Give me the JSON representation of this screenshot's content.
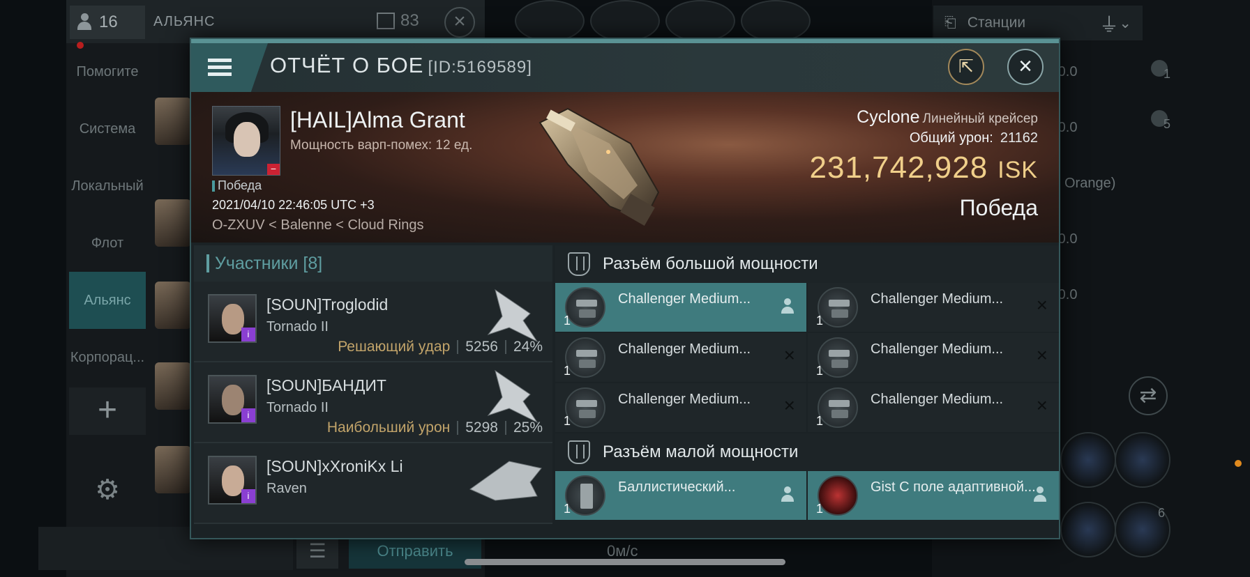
{
  "background": {
    "user_count": "16",
    "channel_name": "АЛЬЯНС",
    "message_count": "83",
    "tabs": [
      "Помогите",
      "Система",
      "Локальный",
      "Флот",
      "Альянс",
      "Корпорац..."
    ],
    "active_tab": "Альянс",
    "send_label": "Отправить",
    "stations_label": "Станции",
    "stat_values": [
      "-0.0",
      "-0.0",
      "-0.0",
      "-0.0"
    ],
    "stat_counts": [
      "1",
      "5"
    ],
    "orange_tag": "Orange)",
    "speed": "0м/с",
    "module_badge": "6"
  },
  "modal": {
    "title": "ОТЧЁТ О БОЕ",
    "report_id": "[ID:5169589]",
    "victim": {
      "name": "[HAIL]Alma Grant",
      "warp_disrupt": "Мощность варп-помех: 12 ед.",
      "result": "Победа",
      "datetime": "2021/04/10 22:46:05 UTC +3",
      "location": "O-ZXUV < Balenne < Cloud Rings",
      "ship_name": "Cyclone",
      "ship_class": "Линейный крейсер",
      "damage_label": "Общий урон:",
      "damage_value": "21162",
      "isk_value": "231,742,928",
      "isk_unit": "ISK",
      "outcome": "Победа"
    },
    "participants": {
      "title": "Участники [8]",
      "rows": [
        {
          "name": "[SOUN]Troglodid",
          "ship": "Tornado II",
          "label": "Решающий удар",
          "damage": "5256",
          "percent": "24%"
        },
        {
          "name": "[SOUN]БАНДИТ",
          "ship": "Tornado II",
          "label": "Наибольший урон",
          "damage": "5298",
          "percent": "25%"
        },
        {
          "name": "[SOUN]xXroniKx Li",
          "ship": "Raven",
          "label": "",
          "damage": "",
          "percent": ""
        }
      ]
    },
    "high_slots": {
      "title": "Разъём большой мощности",
      "modules": [
        {
          "name": "Challenger Medium...",
          "qty": "1",
          "status": "dropped"
        },
        {
          "name": "Challenger Medium...",
          "qty": "1",
          "status": "destroyed"
        },
        {
          "name": "Challenger Medium...",
          "qty": "1",
          "status": "destroyed"
        },
        {
          "name": "Challenger Medium...",
          "qty": "1",
          "status": "destroyed"
        },
        {
          "name": "Challenger Medium...",
          "qty": "1",
          "status": "destroyed"
        },
        {
          "name": "Challenger Medium...",
          "qty": "1",
          "status": "destroyed"
        }
      ]
    },
    "low_slots": {
      "title": "Разъём малой мощности",
      "modules": [
        {
          "name": "Баллистический...",
          "qty": "1",
          "status": "dropped"
        },
        {
          "name": "Gist C поле адаптивной...",
          "qty": "1",
          "status": "dropped"
        }
      ]
    }
  }
}
